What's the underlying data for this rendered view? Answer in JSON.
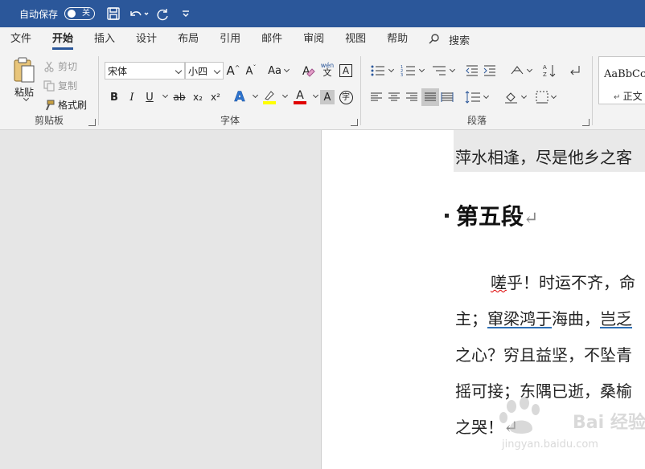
{
  "titlebar": {
    "autosave_label": "自动保存",
    "autosave_state": "关",
    "bg_color": "#2b579a"
  },
  "tabs": [
    {
      "label": "文件"
    },
    {
      "label": "开始",
      "active": true
    },
    {
      "label": "插入"
    },
    {
      "label": "设计"
    },
    {
      "label": "布局"
    },
    {
      "label": "引用"
    },
    {
      "label": "邮件"
    },
    {
      "label": "审阅"
    },
    {
      "label": "视图"
    },
    {
      "label": "帮助"
    }
  ],
  "search": {
    "label": "搜索"
  },
  "clipboard": {
    "title": "剪贴板",
    "paste": "粘贴",
    "cut": "剪切",
    "copy": "复制",
    "format_painter": "格式刷"
  },
  "font": {
    "title": "字体",
    "font_name": "宋体",
    "font_size": "小四",
    "change_case": "Aa",
    "phonetic_top": "wén",
    "phonetic_bottom": "文",
    "bold": "B",
    "italic": "I",
    "underline": "U",
    "strike": "ab",
    "subscript": "x₂",
    "superscript": "x²",
    "text_effect": "A",
    "font_color": "A",
    "char_shading": "A",
    "enclose": "字",
    "highlight_color": "#ffff00",
    "font_color_value": "#e00000"
  },
  "paragraph": {
    "title": "段落"
  },
  "styles": {
    "sample": "AaBbCc",
    "name": "正文"
  },
  "document": {
    "line_top": "萍水相逢，尽是他乡之客",
    "heading": "第五段",
    "para_line1_a": "嗟",
    "para_line1_b": "乎！时运不齐，命",
    "para_line2_a": "主；",
    "para_line2_b": "窜梁鸿于",
    "para_line2_c": "海曲，",
    "para_line2_d": "岂乏",
    "para_line3": "之心？穷且益坚，不坠青",
    "para_line4": "摇可接；东隅已逝，桑榆",
    "para_line5": "之哭！",
    "para_mark": "↵"
  },
  "watermark": {
    "text": "Bai 经验",
    "url": "jingyan.baidu.com"
  }
}
